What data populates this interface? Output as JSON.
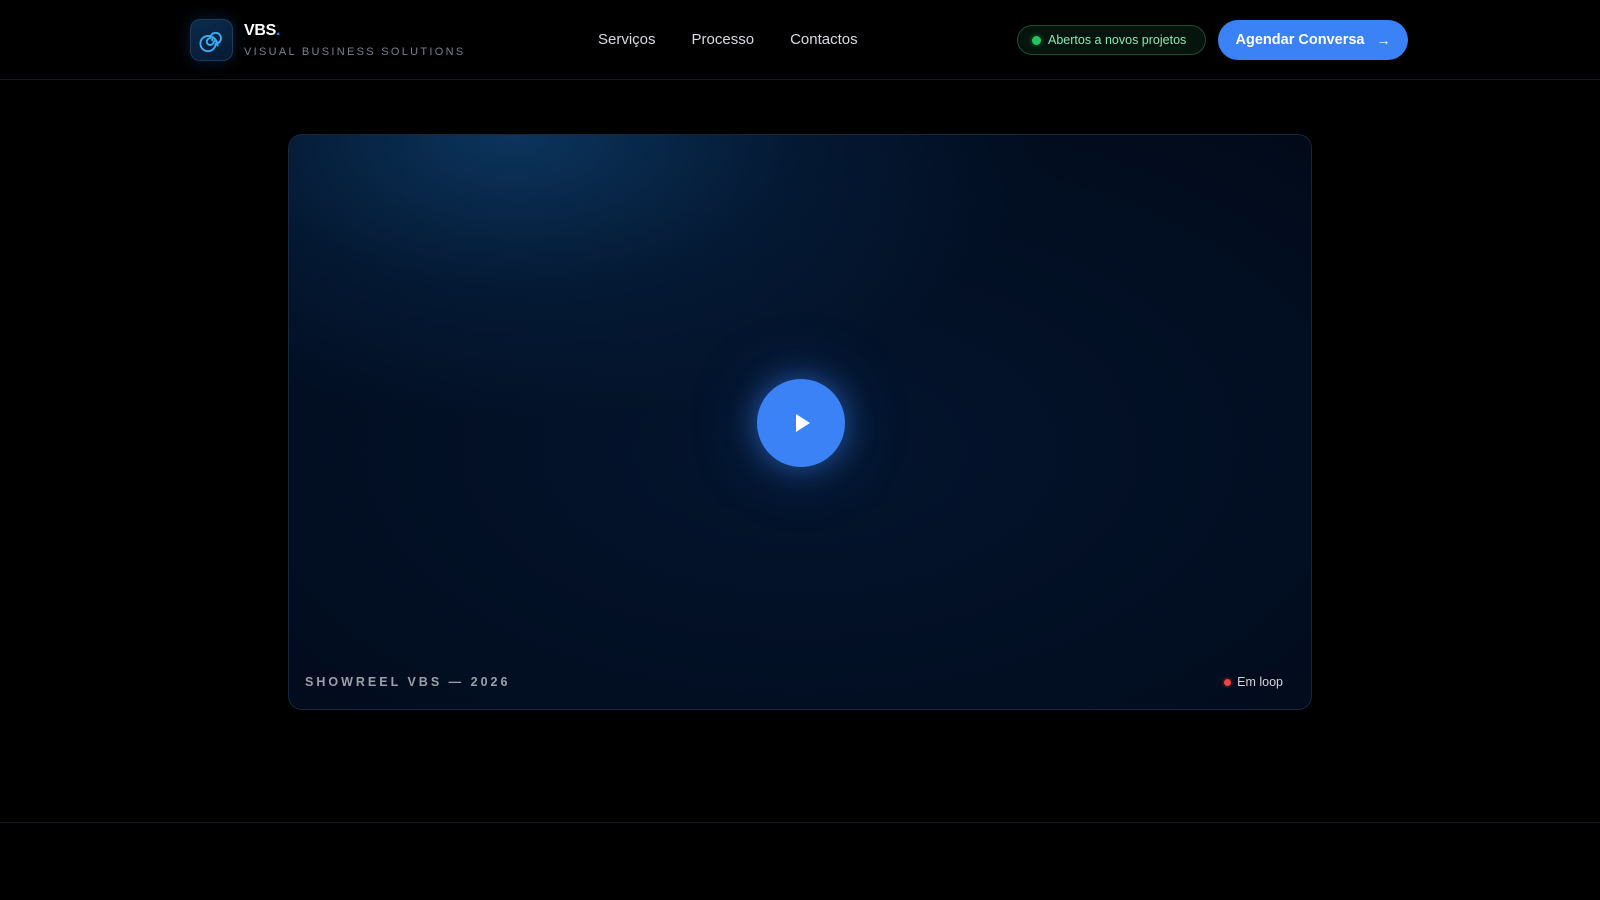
{
  "header": {
    "logo": {
      "title": "VBS",
      "title_dot": ".",
      "subtitle": "VISUAL BUSINESS SOLUTIONS",
      "icon": "spiral-icon",
      "accent": "#3b82f6"
    },
    "nav": [
      {
        "label": "Serviços"
      },
      {
        "label": "Processo"
      },
      {
        "label": "Contactos"
      }
    ],
    "status": {
      "label": "Abertos a novos projetos",
      "color": "#22c55e"
    },
    "cta": {
      "label": "Agendar Conversa",
      "icon": "arrow-right-icon",
      "arrow": "→",
      "color": "#3b82f6"
    }
  },
  "video": {
    "caption": "SHOWREEL VBS — 2026",
    "loop_label": "Em loop",
    "loop_color": "#ef4444",
    "play_icon": "play-icon"
  }
}
